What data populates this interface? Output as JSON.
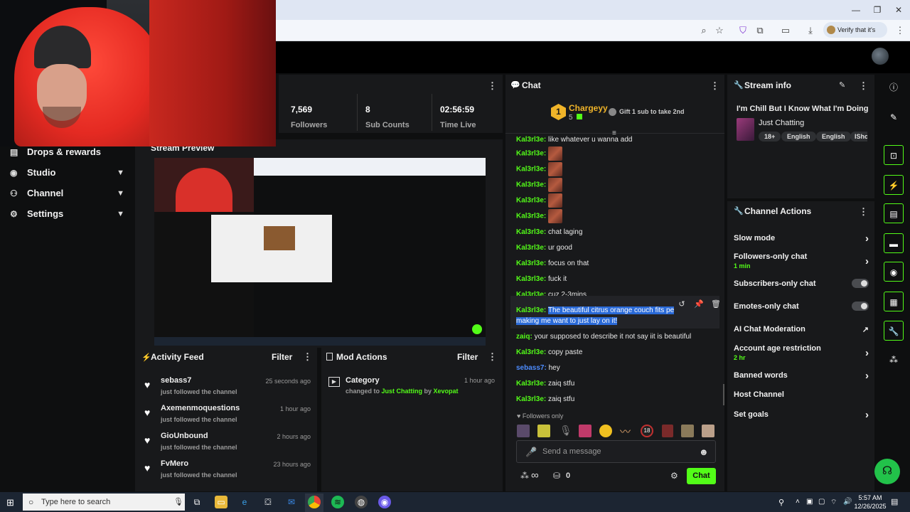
{
  "browser": {
    "verify_label": "Verify that it's you",
    "win_min": "—",
    "win_max": "❐",
    "win_close": "✕"
  },
  "sidebar": {
    "items": [
      {
        "label": "Drops & rewards",
        "icon": "gift-icon"
      },
      {
        "label": "Studio",
        "icon": "studio-icon"
      },
      {
        "label": "Channel",
        "icon": "channel-icon"
      },
      {
        "label": "Settings",
        "icon": "gear-icon"
      }
    ]
  },
  "stats": [
    {
      "value": "7,569",
      "label": "Followers"
    },
    {
      "value": "8",
      "label": "Sub Counts"
    },
    {
      "value": "02:56:59",
      "label": "Time Live"
    }
  ],
  "preview": {
    "title": "Stream Preview"
  },
  "activity_feed": {
    "title": "Activity Feed",
    "filter_label": "Filter",
    "items": [
      {
        "name": "sebass7",
        "action": "just followed the channel",
        "time": "25 seconds ago"
      },
      {
        "name": "Axemenmoquestions",
        "action": "just followed the channel",
        "time": "1 hour ago"
      },
      {
        "name": "GioUnbound",
        "action": "just followed the channel",
        "time": "2 hours ago"
      },
      {
        "name": "FvMero",
        "action": "just followed the channel",
        "time": "23 hours ago"
      }
    ]
  },
  "mod_actions": {
    "title": "Mod Actions",
    "filter_label": "Filter",
    "items": [
      {
        "title": "Category",
        "prefix": "changed to ",
        "value": "Just Chatting",
        "by_label": " by ",
        "by": "Xevopat",
        "time": "1 hour ago"
      }
    ]
  },
  "chat": {
    "title": "Chat",
    "gifter_rank": "1",
    "gifter_name": "Chargeyy",
    "gifter_count": "5",
    "gift_prompt": "Gift 1 sub to take 2nd",
    "truncated_line": {
      "user": "Kal3rl3e:",
      "text": " like whatever u wanna add"
    },
    "messages": [
      {
        "user": "Kal3rl3e:",
        "text": "chat laging"
      },
      {
        "user": "Kal3rl3e:",
        "text": "ur good"
      },
      {
        "user": "Kal3rl3e:",
        "text": "focus on that"
      },
      {
        "user": "Kal3rl3e:",
        "text": "fuck it"
      },
      {
        "user": "Kal3rl3e:",
        "text": "cuz 2-3mins"
      }
    ],
    "emote_user": "Kal3rl3e:",
    "highlighted": {
      "user": "Kal3rl3e:",
      "text_a": "The beautiful citrus orange couch fits pe",
      "text_b": "making me want to just lay on it!"
    },
    "after": [
      {
        "user": "zaiq:",
        "text": "your supposed to describe it not say iit is beautiful",
        "blue": false
      },
      {
        "user": "Kal3rl3e:",
        "text": "copy paste",
        "blue": false
      },
      {
        "user": "sebass7:",
        "text": "hey",
        "blue": true
      },
      {
        "user": "Kal3rl3e:",
        "text": "zaiq stfu",
        "blue": false
      },
      {
        "user": "Kal3rl3e:",
        "text": "zaiq stfu",
        "blue": false
      }
    ],
    "followers_only": "Followers only",
    "input_placeholder": "Send a message",
    "infinity": "∞",
    "bucket_count": "0",
    "send_label": "Chat"
  },
  "stream_info": {
    "title": "Stream info",
    "stream_title": "I'm Chill But I Know What I'm Doing",
    "category": "Just Chatting",
    "tags": [
      "18+",
      "English",
      "English",
      "IShc"
    ]
  },
  "channel_actions": {
    "title": "Channel Actions",
    "items": [
      {
        "label": "Slow mode",
        "sub": "",
        "control": "chevron"
      },
      {
        "label": "Followers-only chat",
        "sub": "1 min",
        "control": "chevron"
      },
      {
        "label": "Subscribers-only chat",
        "sub": "",
        "control": "toggle"
      },
      {
        "label": "Emotes-only chat",
        "sub": "",
        "control": "toggle"
      },
      {
        "label": "AI Chat Moderation",
        "sub": "",
        "control": "external"
      },
      {
        "label": "Account age restriction",
        "sub": "2 hr",
        "control": "chevron"
      },
      {
        "label": "Banned words",
        "sub": "",
        "control": "chevron"
      },
      {
        "label": "Host Channel",
        "sub": "",
        "control": "none"
      },
      {
        "label": "Set goals",
        "sub": "",
        "control": "chevron"
      }
    ]
  },
  "taskbar": {
    "search_placeholder": "Type here to search",
    "time": "5:57 AM",
    "date": "12/26/2025"
  },
  "colors": {
    "accent": "#53fc18",
    "panel": "#18191b",
    "highlight": "#2a6ad8"
  }
}
